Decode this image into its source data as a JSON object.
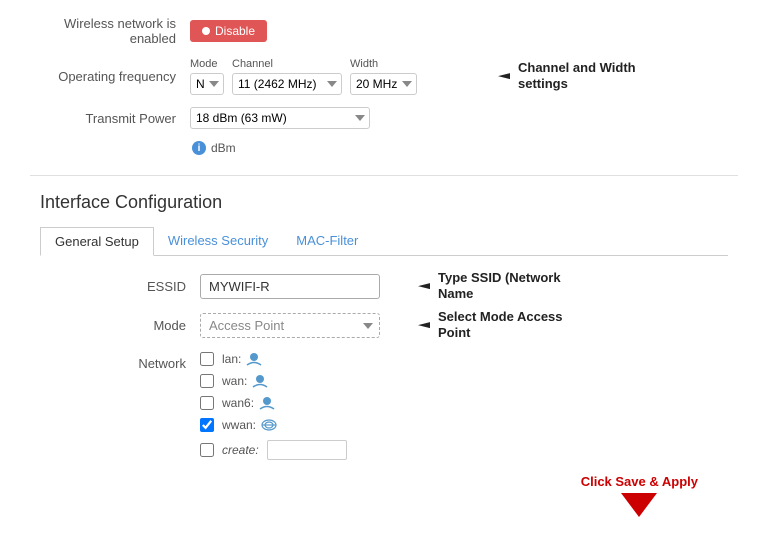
{
  "wireless": {
    "status_label": "Wireless network is enabled",
    "disable_button": "Disable",
    "operating_frequency_label": "Operating frequency",
    "mode_label": "Mode",
    "channel_label": "Channel",
    "width_label": "Width",
    "mode_value": "N",
    "channel_value": "11 (2462 MHz)",
    "width_value": "20 MHz",
    "channel_width_annotation": "Channel and Width settings",
    "transmit_power_label": "Transmit Power",
    "transmit_power_value": "18 dBm (63 mW)",
    "dbm_label": "dBm"
  },
  "interface_config": {
    "section_title": "Interface Configuration",
    "tabs": [
      {
        "label": "General Setup",
        "active": true
      },
      {
        "label": "Wireless Security",
        "active": false
      },
      {
        "label": "MAC-Filter",
        "active": false
      }
    ],
    "essid_label": "ESSID",
    "essid_value": "MYWIFI-R",
    "essid_annotation": "Type SSID (Network Name",
    "mode_label": "Mode",
    "mode_value": "Access Point",
    "mode_annotation": "Select Mode Access Point",
    "network_label": "Network",
    "network_options": [
      {
        "id": "lan",
        "label": "lan:",
        "icon": "person",
        "checked": false
      },
      {
        "id": "wan",
        "label": "wan:",
        "icon": "person",
        "checked": false
      },
      {
        "id": "wan6",
        "label": "wan6:",
        "icon": "person",
        "checked": false
      },
      {
        "id": "wwan",
        "label": "wwan:",
        "icon": "globe",
        "checked": true
      }
    ],
    "create_placeholder": "",
    "create_label": "create:",
    "save_apply_text": "Click Save & Apply"
  }
}
